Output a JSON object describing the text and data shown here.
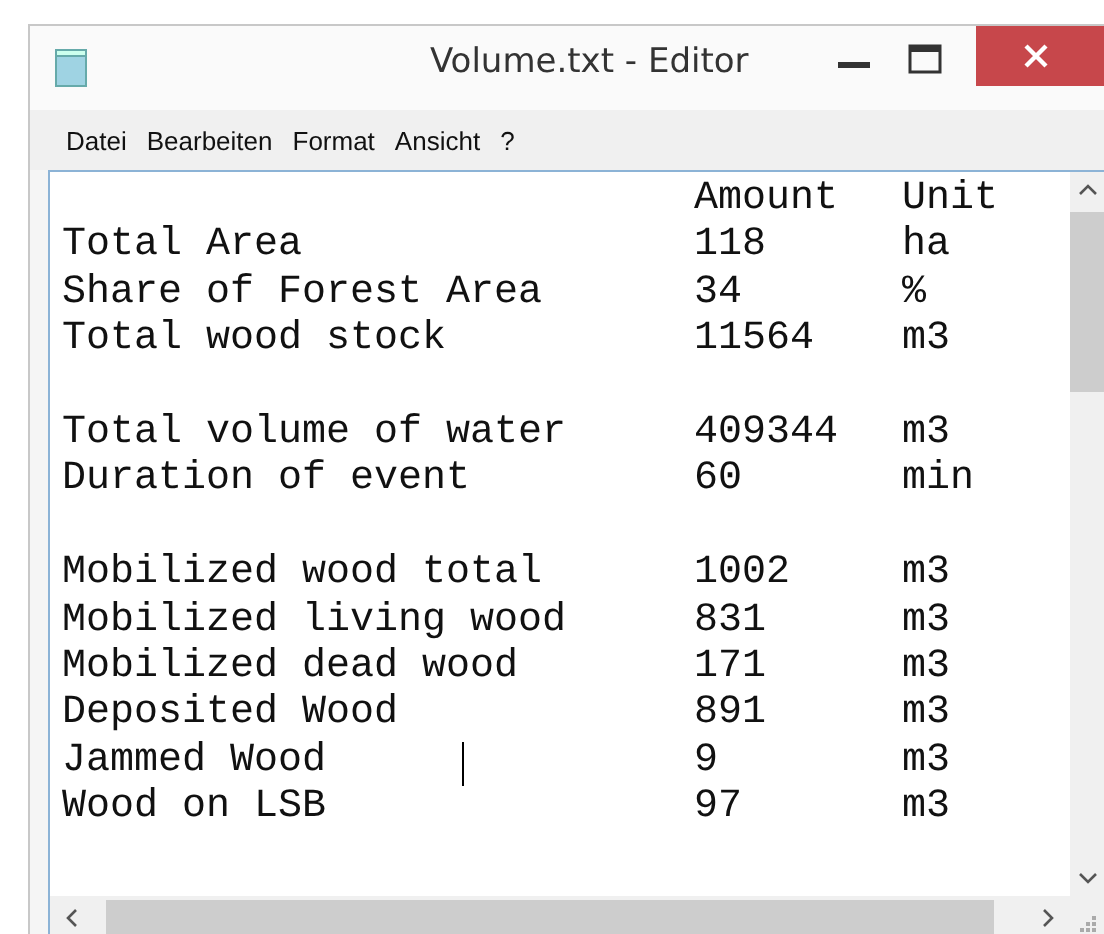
{
  "window": {
    "title": "Volume.txt - Editor"
  },
  "menu": [
    "Datei",
    "Bearbeiten",
    "Format",
    "Ansicht",
    "?"
  ],
  "header": {
    "amount": "Amount",
    "unit": "Unit"
  },
  "groups": [
    [
      {
        "label": "Total Area",
        "amount": "118",
        "unit": "ha",
        "cursor": false
      },
      {
        "label": "Share of Forest Area",
        "amount": "34",
        "unit": "%",
        "cursor": false
      },
      {
        "label": "Total wood stock",
        "amount": "11564",
        "unit": "m3",
        "cursor": false
      }
    ],
    [
      {
        "label": "Total volume of water",
        "amount": "409344",
        "unit": "m3",
        "cursor": false
      },
      {
        "label": "Duration of event",
        "amount": "60",
        "unit": "min",
        "cursor": false
      }
    ],
    [
      {
        "label": "Mobilized wood total",
        "amount": "1002",
        "unit": "m3",
        "cursor": false
      },
      {
        "label": "Mobilized living wood",
        "amount": "831",
        "unit": "m3",
        "cursor": false
      },
      {
        "label": "Mobilized dead wood",
        "amount": "171",
        "unit": "m3",
        "cursor": false
      },
      {
        "label": "Deposited Wood",
        "amount": "891",
        "unit": "m3",
        "cursor": false
      },
      {
        "label": "Jammed Wood",
        "amount": "9",
        "unit": "m3",
        "cursor": true
      },
      {
        "label": "Wood on LSB",
        "amount": "97",
        "unit": "m3",
        "cursor": false
      }
    ]
  ]
}
